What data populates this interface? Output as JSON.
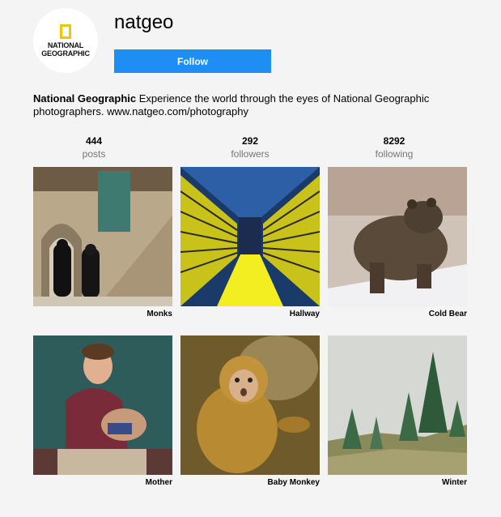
{
  "profile": {
    "username": "natgeo",
    "logo_text_line1": "NATIONAL",
    "logo_text_line2": "GEOGRAPHIC",
    "follow_label": "Follow",
    "bio_name": "National Geographic",
    "bio_text": "Experience the world through the eyes of National Geographic photographers. www.natgeo.com/photography"
  },
  "stats": [
    {
      "value": "444",
      "label": "posts"
    },
    {
      "value": "292",
      "label": "followers"
    },
    {
      "value": "8292",
      "label": "following"
    }
  ],
  "posts": [
    {
      "caption": "Monks"
    },
    {
      "caption": "Hallway"
    },
    {
      "caption": "Cold Bear"
    },
    {
      "caption": "Mother"
    },
    {
      "caption": "Baby Monkey"
    },
    {
      "caption": "Winter"
    }
  ],
  "colors": {
    "follow_button": "#1e8ef5",
    "logo_yellow": "#f5c400",
    "background": "#f4f4f4"
  }
}
